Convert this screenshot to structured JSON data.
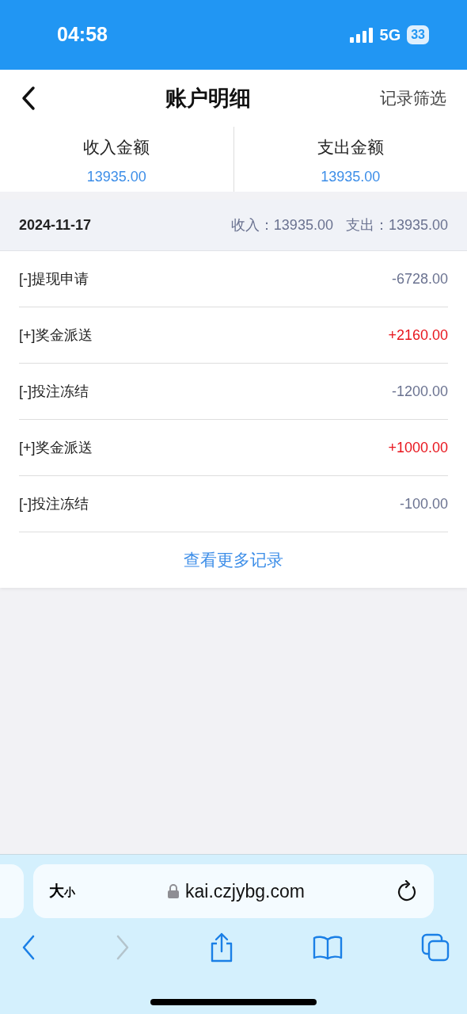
{
  "status_bar": {
    "time": "04:58",
    "network": "5G",
    "battery": "33"
  },
  "header": {
    "title": "账户明细",
    "action": "记录筛选"
  },
  "summary": [
    {
      "label": "收入金额",
      "amount": "13935.00"
    },
    {
      "label": "支出金额",
      "amount": "13935.00"
    }
  ],
  "day": {
    "date": "2024-11-17",
    "income": "收入：13935.00",
    "expense": "支出：13935.00"
  },
  "records": [
    {
      "kind": "expense",
      "label": "[-]提现申请",
      "amount": "-6728.00"
    },
    {
      "kind": "income",
      "label": "[+]奖金派送",
      "amount": "+2160.00"
    },
    {
      "kind": "expense",
      "label": "[-]投注冻结",
      "amount": "-1200.00"
    },
    {
      "kind": "income",
      "label": "[+]奖金派送",
      "amount": "+1000.00"
    },
    {
      "kind": "expense",
      "label": "[-]投注冻结",
      "amount": "-100.00"
    }
  ],
  "more_link": "查看更多记录",
  "browser": {
    "text_size": [
      "大",
      "小"
    ],
    "url": "kai.czjybg.com",
    "forward_disabled": true
  }
}
